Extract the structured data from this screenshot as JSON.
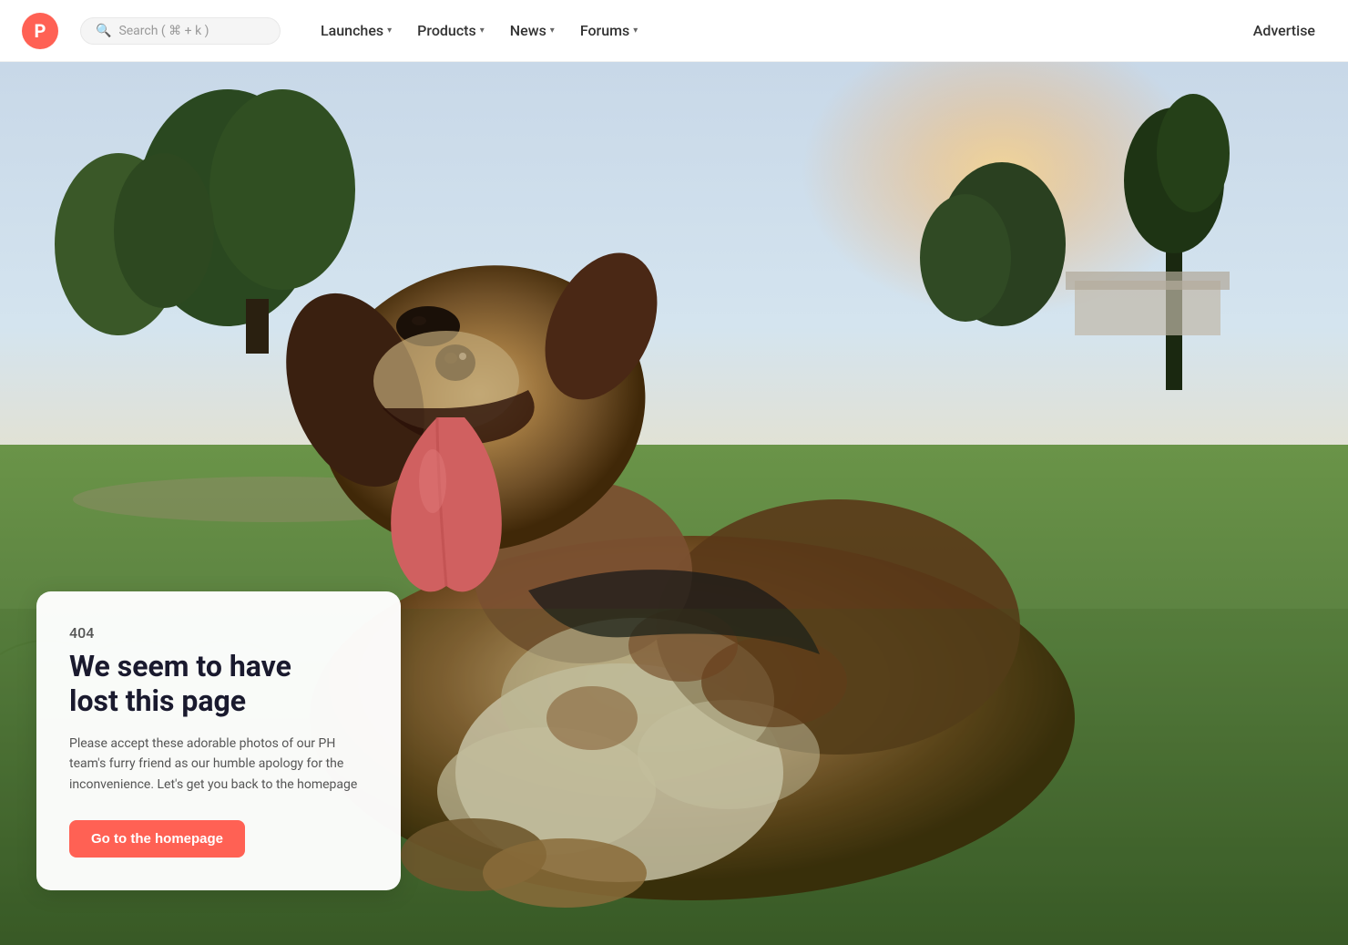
{
  "navbar": {
    "logo_letter": "P",
    "search_placeholder": "Search ( ⌘ + k )",
    "nav_items": [
      {
        "label": "Launches",
        "has_chevron": true
      },
      {
        "label": "Products",
        "has_chevron": true
      },
      {
        "label": "News",
        "has_chevron": true
      },
      {
        "label": "Forums",
        "has_chevron": true
      },
      {
        "label": "Advertise",
        "has_chevron": false
      }
    ]
  },
  "error_page": {
    "code": "404",
    "title_line1": "We seem to have",
    "title_line2": "lost this page",
    "description": "Please accept these adorable photos of our PH team's furry friend as our humble apology for the inconvenience. Let's get you back to the homepage",
    "button_label": "Go to the homepage"
  }
}
